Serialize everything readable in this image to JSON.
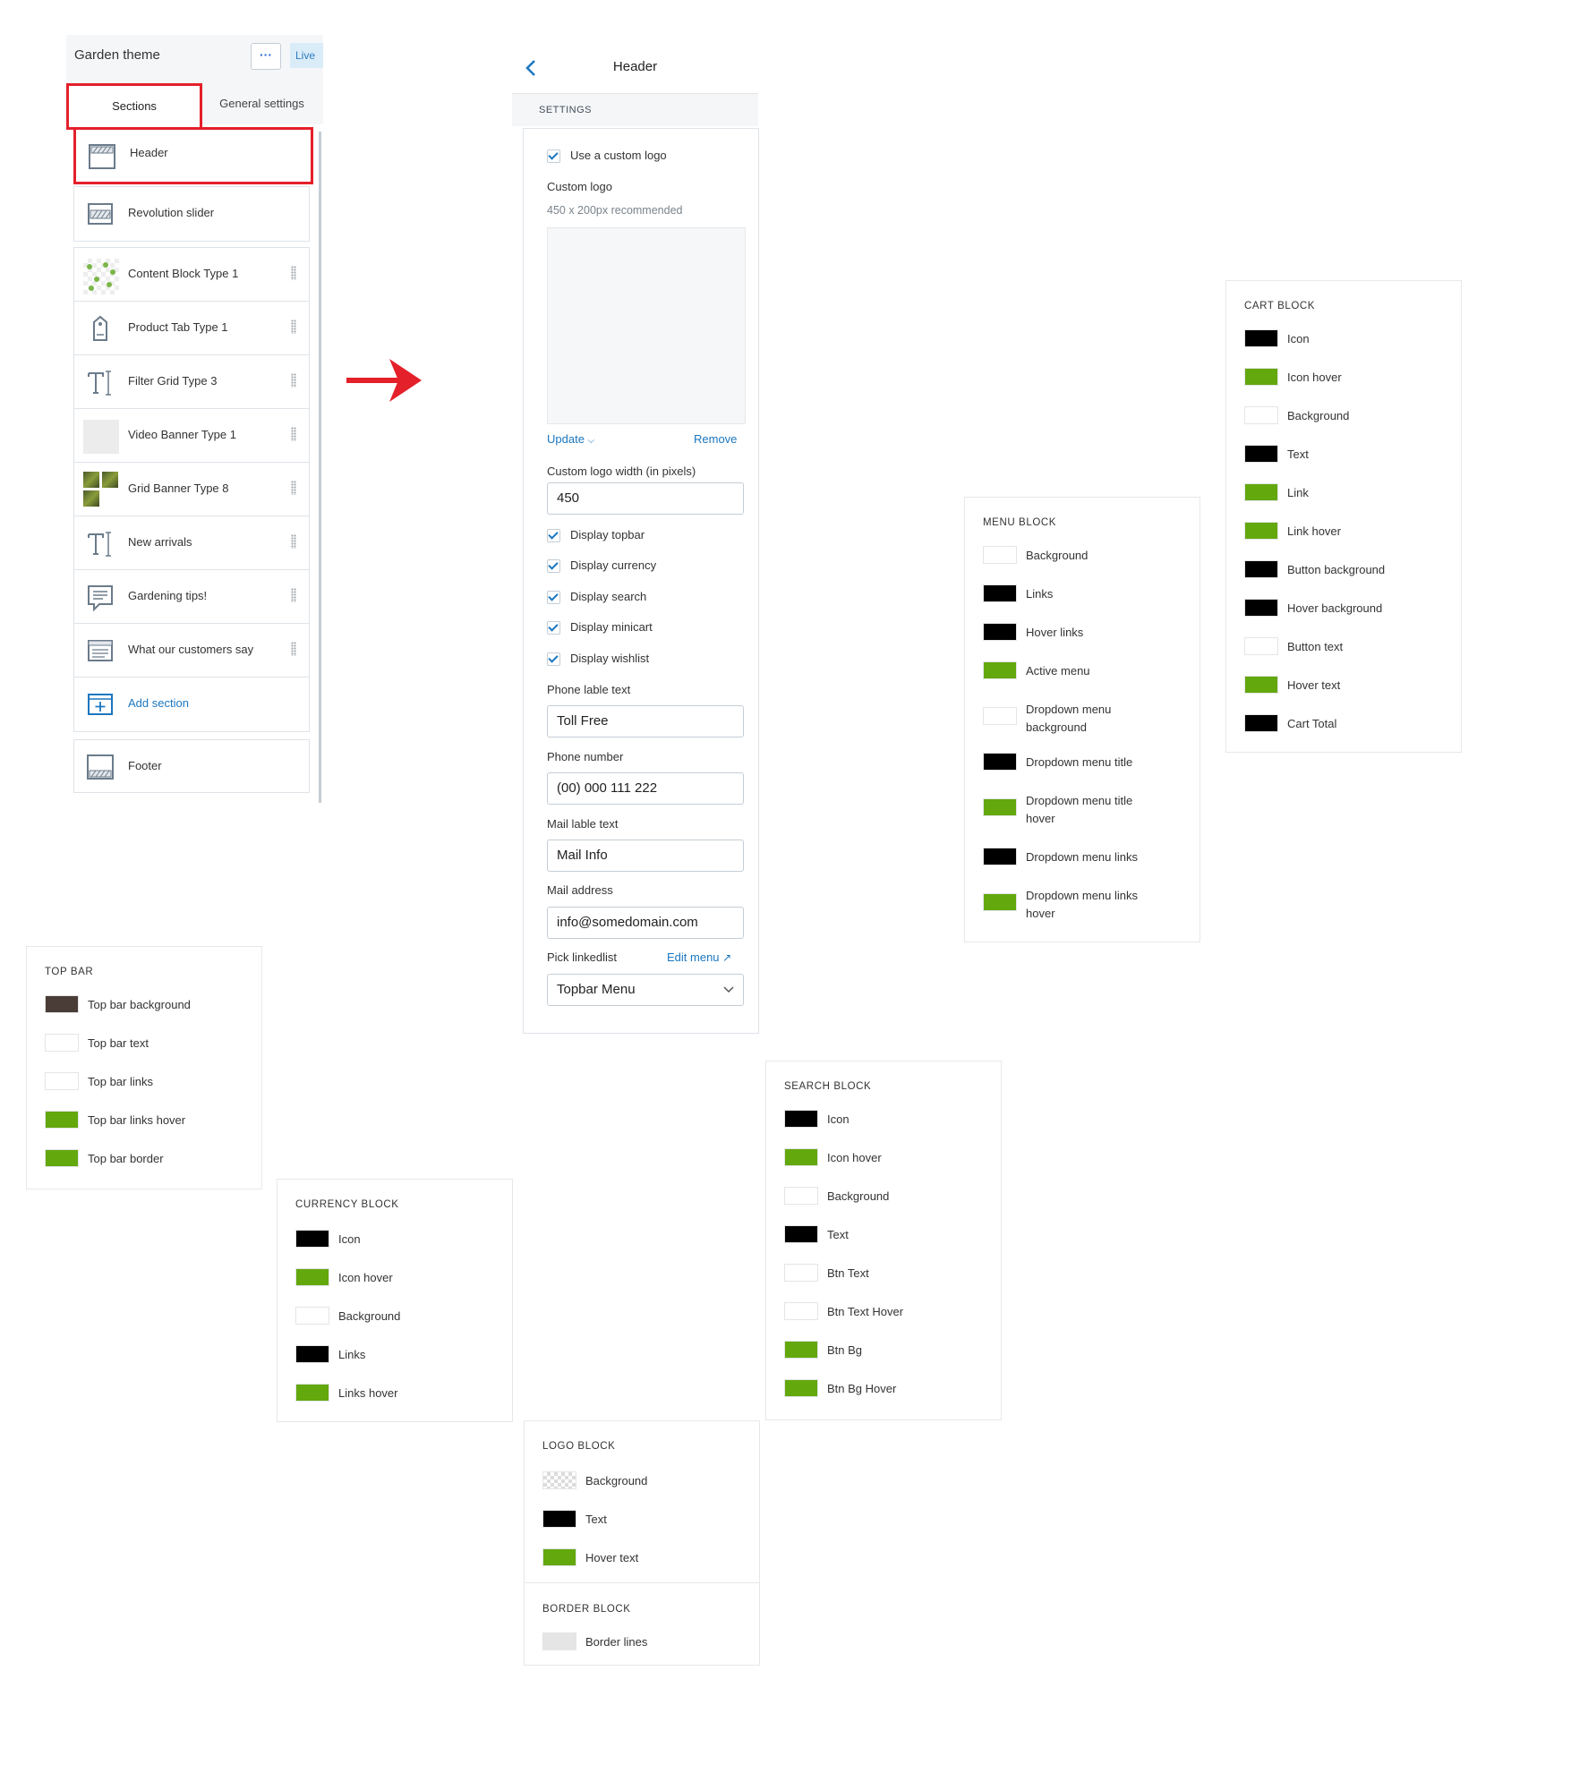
{
  "colors": {
    "green": "#63a80d",
    "black": "#000000",
    "white": "#ffffff",
    "brown": "#4a3c36",
    "lightgray": "#e5e5e5",
    "accent_red": "#e4202a",
    "link_blue": "#1b77c0"
  },
  "theme_panel": {
    "title": "Garden theme",
    "more_label": "···",
    "live_badge": "Live",
    "tabs": [
      "Sections",
      "General settings"
    ],
    "sections": [
      {
        "label": "Header",
        "icon": "header-section-icon",
        "selected": true
      },
      {
        "label": "Revolution slider",
        "icon": "slideshow-section-icon"
      },
      {
        "label": "Content Block Type 1",
        "icon": "content-block-thumbnail"
      },
      {
        "label": "Product Tab Type 1",
        "icon": "product-tag-icon"
      },
      {
        "label": "Filter Grid Type 3",
        "icon": "text-icon"
      },
      {
        "label": "Video Banner Type 1",
        "icon": "video-thumbnail"
      },
      {
        "label": "Grid Banner Type 8",
        "icon": "photo-grid-thumbnail"
      },
      {
        "label": "New arrivals",
        "icon": "text-icon"
      },
      {
        "label": "Gardening tips!",
        "icon": "blog-icon"
      },
      {
        "label": "What our customers say",
        "icon": "testimonial-icon"
      },
      {
        "label": "Add section",
        "icon": "add-section-icon"
      },
      {
        "label": "Footer",
        "icon": "footer-section-icon"
      }
    ]
  },
  "header_panel": {
    "title": "Header",
    "settings_heading": "SETTINGS",
    "use_custom_logo": "Use a custom logo",
    "custom_logo_label": "Custom logo",
    "custom_logo_hint": "450 x 200px recommended",
    "update_label": "Update",
    "remove_label": "Remove",
    "logo_width_label": "Custom logo width (in pixels)",
    "logo_width_value": "450",
    "checkboxes": [
      "Display topbar",
      "Display currency",
      "Display search",
      "Display minicart",
      "Display wishlist"
    ],
    "phone_label_label": "Phone lable text",
    "phone_label_value": "Toll Free",
    "phone_number_label": "Phone number",
    "phone_number_value": "(00) 000 111 222",
    "mail_label_label": "Mail lable text",
    "mail_label_value": "Mail Info",
    "mail_address_label": "Mail address",
    "mail_address_value": "info@somedomain.com",
    "linklist_label": "Pick linkedlist",
    "edit_menu_label": "Edit menu",
    "linklist_value": "Topbar Menu"
  },
  "blocks": {
    "top_bar": {
      "title": "TOP BAR",
      "rows": [
        {
          "label": "Top bar background",
          "color": "#4a3c36"
        },
        {
          "label": "Top bar text",
          "color": "#ffffff"
        },
        {
          "label": "Top bar links",
          "color": "#ffffff"
        },
        {
          "label": "Top bar links hover",
          "color": "#63a80d"
        },
        {
          "label": "Top bar border",
          "color": "#63a80d"
        }
      ]
    },
    "currency": {
      "title": "CURRENCY BLOCK",
      "rows": [
        {
          "label": "Icon",
          "color": "#000000"
        },
        {
          "label": "Icon hover",
          "color": "#63a80d"
        },
        {
          "label": "Background",
          "color": "#ffffff"
        },
        {
          "label": "Links",
          "color": "#000000"
        },
        {
          "label": "Links hover",
          "color": "#63a80d"
        }
      ]
    },
    "logo": {
      "title": "LOGO BLOCK",
      "rows": [
        {
          "label": "Background",
          "color": "transparent"
        },
        {
          "label": "Text",
          "color": "#000000"
        },
        {
          "label": "Hover text",
          "color": "#63a80d"
        }
      ]
    },
    "border": {
      "title": "BORDER BLOCK",
      "rows": [
        {
          "label": "Border lines",
          "color": "#e5e5e5"
        }
      ]
    },
    "search": {
      "title": "SEARCH BLOCK",
      "rows": [
        {
          "label": "Icon",
          "color": "#000000"
        },
        {
          "label": "Icon hover",
          "color": "#63a80d"
        },
        {
          "label": "Background",
          "color": "#ffffff"
        },
        {
          "label": "Text",
          "color": "#000000"
        },
        {
          "label": "Btn Text",
          "color": "#ffffff"
        },
        {
          "label": "Btn Text Hover",
          "color": "#ffffff"
        },
        {
          "label": "Btn Bg",
          "color": "#63a80d"
        },
        {
          "label": "Btn Bg Hover",
          "color": "#63a80d"
        }
      ]
    },
    "menu": {
      "title": "MENU BLOCK",
      "rows": [
        {
          "label": "Background",
          "color": "#ffffff"
        },
        {
          "label": "Links",
          "color": "#000000"
        },
        {
          "label": "Hover links",
          "color": "#000000"
        },
        {
          "label": "Active menu",
          "color": "#63a80d"
        },
        {
          "label": "Dropdown menu background",
          "color": "#ffffff"
        },
        {
          "label": "Dropdown menu title",
          "color": "#000000"
        },
        {
          "label": "Dropdown menu title hover",
          "color": "#63a80d"
        },
        {
          "label": "Dropdown menu links",
          "color": "#000000"
        },
        {
          "label": "Dropdown menu links hover",
          "color": "#63a80d"
        }
      ]
    },
    "cart": {
      "title": "CART BLOCK",
      "rows": [
        {
          "label": "Icon",
          "color": "#000000"
        },
        {
          "label": "Icon hover",
          "color": "#63a80d"
        },
        {
          "label": "Background",
          "color": "#ffffff"
        },
        {
          "label": "Text",
          "color": "#000000"
        },
        {
          "label": "Link",
          "color": "#63a80d"
        },
        {
          "label": "Link hover",
          "color": "#63a80d"
        },
        {
          "label": "Button background",
          "color": "#000000"
        },
        {
          "label": "Hover background",
          "color": "#000000"
        },
        {
          "label": "Button text",
          "color": "#ffffff"
        },
        {
          "label": "Hover text",
          "color": "#63a80d"
        },
        {
          "label": "Cart Total",
          "color": "#000000"
        }
      ]
    }
  }
}
